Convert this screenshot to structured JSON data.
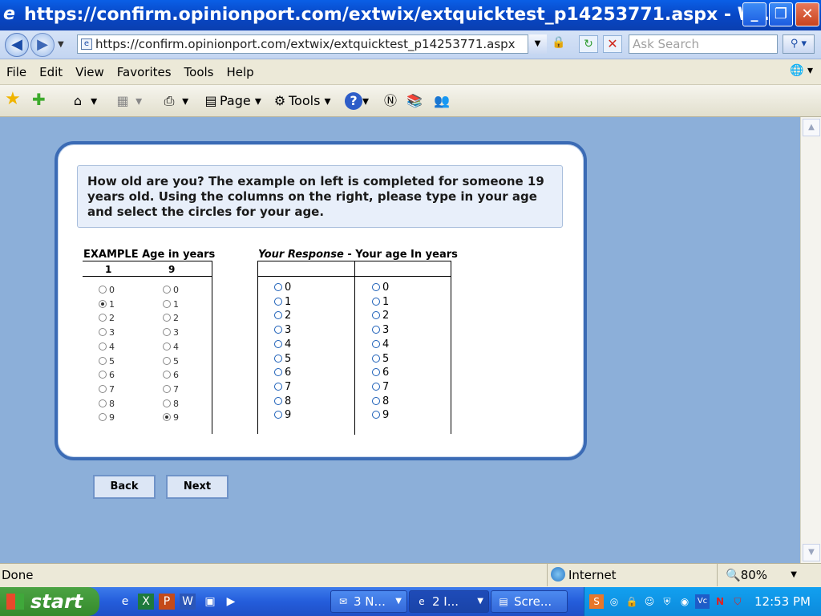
{
  "window": {
    "title": "https://confirm.opinionport.com/extwix/extquicktest_p14253771.aspx - Wi...",
    "min_label": "_",
    "max_label": "❐",
    "close_label": "✕"
  },
  "addressbar": {
    "url": "https://confirm.opinionport.com/extwix/extquicktest_p14253771.aspx",
    "search_placeholder": "Ask Search"
  },
  "menu": {
    "items": [
      "File",
      "Edit",
      "View",
      "Favorites",
      "Tools",
      "Help"
    ]
  },
  "commandbar": {
    "page_label": "Page",
    "tools_label": "Tools"
  },
  "survey": {
    "question": "How old are you? The example on left is completed for someone 19 years old. Using the columns on the right, please type in your age and select the circles for your age.",
    "example_header": "EXAMPLE Age in years",
    "example_col1_value": "1",
    "example_col2_value": "9",
    "example_col1_selected": "1",
    "example_col2_selected": "9",
    "response_header_em": "Your Response",
    "response_header_rest": " - Your age In years",
    "options": [
      "0",
      "1",
      "2",
      "3",
      "4",
      "5",
      "6",
      "7",
      "8",
      "9"
    ],
    "back_label": "Back",
    "next_label": "Next"
  },
  "statusbar": {
    "status": "Done",
    "zone": "Internet",
    "zoom": "80%"
  },
  "taskbar": {
    "start_label": "start",
    "tasks": [
      {
        "label": "3 N..."
      },
      {
        "label": "2 I..."
      },
      {
        "label": "Scre..."
      }
    ],
    "clock": "12:53 PM"
  },
  "colors": {
    "page_bg": "#8CAFD9",
    "card_border": "#3B6BB5",
    "question_bg": "#E8EFFA"
  }
}
